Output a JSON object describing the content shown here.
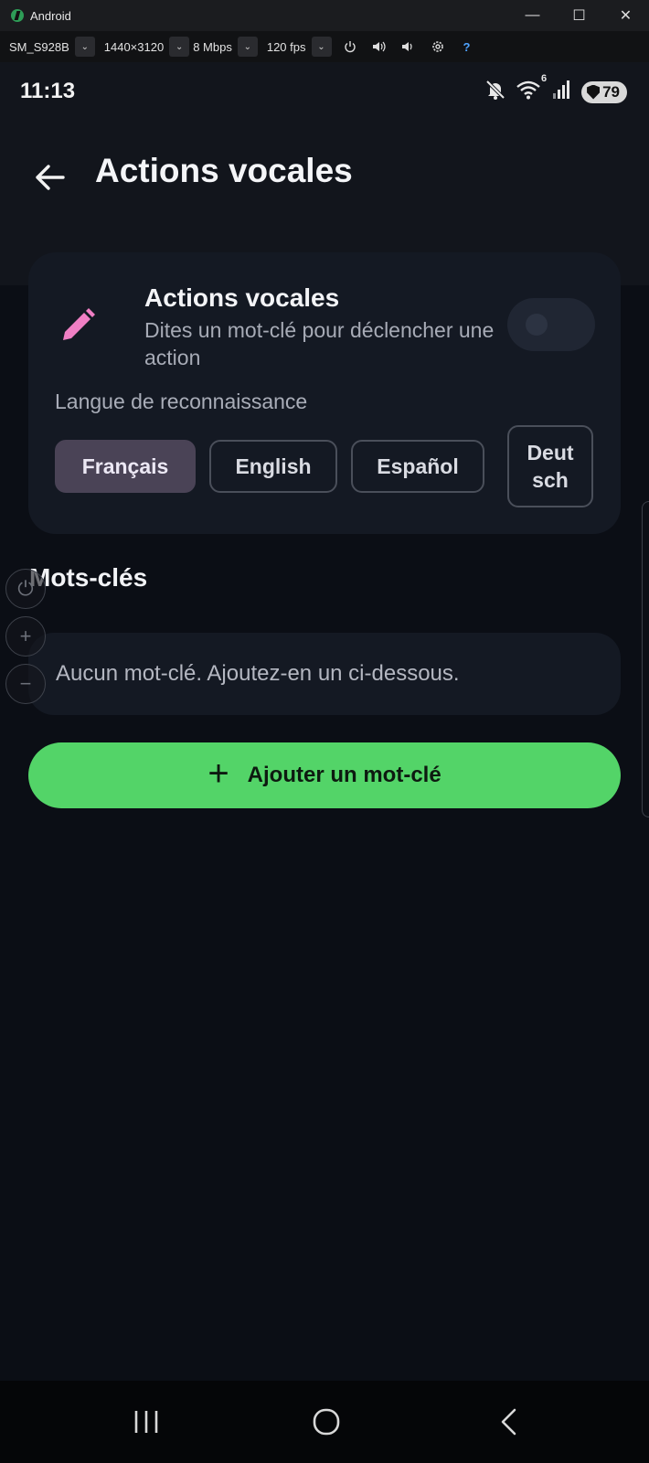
{
  "window": {
    "title": "Android",
    "controls": [
      "—",
      "☐",
      "✕"
    ]
  },
  "toolbar": {
    "device": "SM_S928B",
    "resolution": "1440×3120",
    "bitrate": "8 Mbps",
    "fps": "120 fps",
    "help": "?"
  },
  "status_bar": {
    "time": "11:13",
    "battery": "79",
    "wifi_badge": "6"
  },
  "app_bar": {
    "title": "Actions vocales"
  },
  "voice_card": {
    "title": "Actions vocales",
    "subtitle": "Dites un mot-clé pour déclencher une action",
    "toggle_on": false,
    "language_label": "Langue de reconnaissance",
    "languages": [
      "Français",
      "English",
      "Español",
      "Deutsch"
    ],
    "selected_language": "Français"
  },
  "keywords": {
    "section_title": "Mots-clés",
    "empty_text": "Aucun mot-clé. Ajoutez-en un ci-dessous.",
    "add_button_label": "Ajouter un mot-clé"
  },
  "colors": {
    "accent_green": "#53d468",
    "edit_icon_pink": "#f07fc4",
    "selected_chip": "#4a4356",
    "background": "#0b0e15",
    "card": "#141923"
  },
  "icons": {
    "back": "arrow-left-icon",
    "edit": "pencil-icon",
    "add": "plus-icon",
    "nav_recents": "recents-icon",
    "nav_home": "home-icon",
    "nav_back": "chevron-left-icon"
  }
}
